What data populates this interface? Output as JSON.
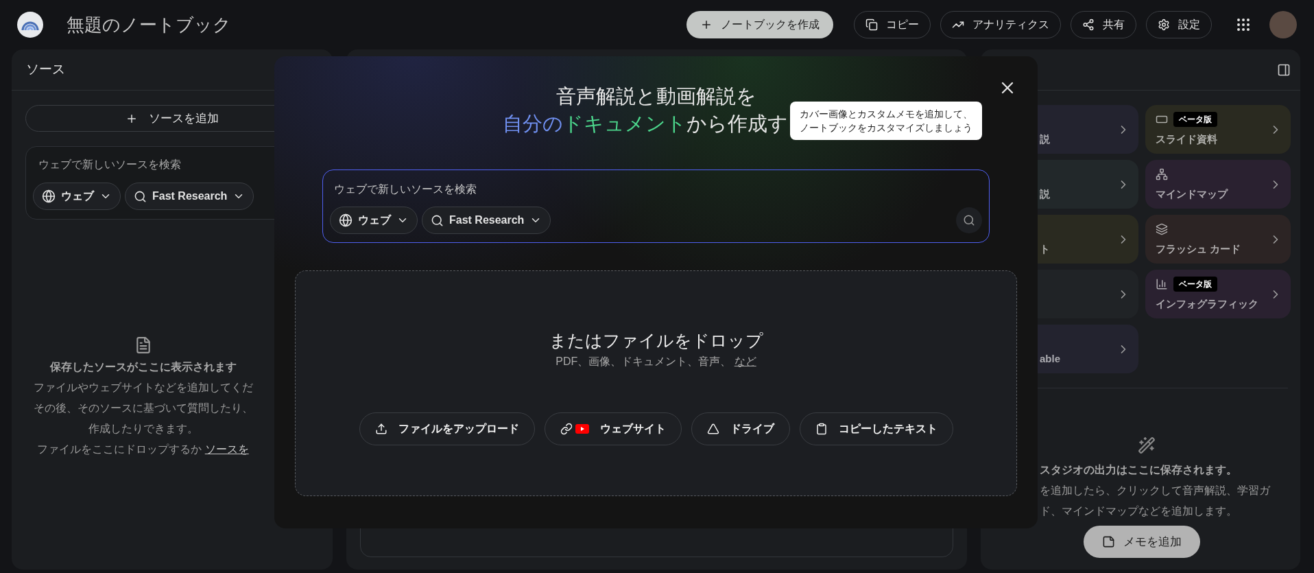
{
  "app": {
    "title": "無題のノートブック"
  },
  "toolbar": {
    "create_button": "ノートブックを作成",
    "buttons": [
      {
        "kind": "copy",
        "label": "コピー"
      },
      {
        "kind": "analytics",
        "label": "アナリティクス"
      },
      {
        "kind": "share",
        "label": "共有"
      },
      {
        "kind": "settings",
        "label": "設定"
      }
    ]
  },
  "sources_panel": {
    "title": "ソース",
    "add_button": "ソースを追加",
    "search": {
      "placeholder": "ウェブで新しいソースを検索",
      "chips": [
        {
          "kind": "web",
          "label": "ウェブ"
        },
        {
          "kind": "research",
          "label": "Fast Research"
        }
      ]
    },
    "empty_state": {
      "heading": "保存したソースがここに表示されます",
      "lines": [
        "ファイルやウェブサイトなどを追加してくだ",
        "その後、そのソースに基づいて質問したり、",
        "作成したりできます。"
      ],
      "drop_prompt": "ファイルをここにドロップするか",
      "drop_link": "ソースを"
    }
  },
  "studio_panel": {
    "tile_columns": [
      [
        {
          "kind": "partial",
          "label": "説",
          "color": "#23232f"
        },
        {
          "kind": "partial",
          "label": "説",
          "color": "#22282a"
        },
        {
          "kind": "partial",
          "label": "ト",
          "color": "#2a2a20"
        },
        {
          "kind": "partial",
          "color": "#202326"
        },
        {
          "kind": "partial",
          "label": "able",
          "color": "#23232f"
        }
      ],
      [
        {
          "kind": "slides",
          "label": "スライド資料",
          "badge": "ベータ版",
          "color": "#2a2a20"
        },
        {
          "kind": "mindmap",
          "label": "マインドマップ",
          "color": "#2a2130"
        },
        {
          "kind": "flashcards",
          "label": "フラッシュ カード",
          "color": "#2c2424"
        },
        {
          "kind": "infographic",
          "label": "インフォグラフィック",
          "badge": "ベータ版",
          "color": "#2a2130"
        }
      ]
    ],
    "empty_state": {
      "heading": "スタジオの出力はここに保存されます。",
      "lines": [
        "を追加したら、クリックして音声解説、学習ガ",
        "ド、マインドマップなどを追加します。"
      ]
    },
    "note_button": "メモを追加"
  },
  "dialog": {
    "headline": "音声解説と動画解説を",
    "subheadline": [
      {
        "text": "自分の",
        "color": "#7090f0"
      },
      {
        "text": "ドキュメント",
        "color": "#4cd68c"
      },
      {
        "text": "から作成す",
        "color": "#e6e6e6"
      }
    ],
    "tooltip": "カバー画像とカスタムメモを追加して、ノートブックをカスタマイズしましょう",
    "search": {
      "placeholder": "ウェブで新しいソースを検索",
      "chips": [
        {
          "kind": "web",
          "label": "ウェブ"
        },
        {
          "kind": "research",
          "label": "Fast Research"
        }
      ]
    },
    "drop_zone": {
      "title": "またはファイルをドロップ",
      "formats": "PDF、画像、ドキュメント、音声、",
      "more_link": "など",
      "buttons": [
        {
          "kind": "upload",
          "label": "ファイルをアップロード"
        },
        {
          "kind": "website",
          "label": "ウェブサイト"
        },
        {
          "kind": "drive",
          "label": "ドライブ"
        },
        {
          "kind": "paste",
          "label": "コピーしたテキスト"
        }
      ]
    }
  }
}
